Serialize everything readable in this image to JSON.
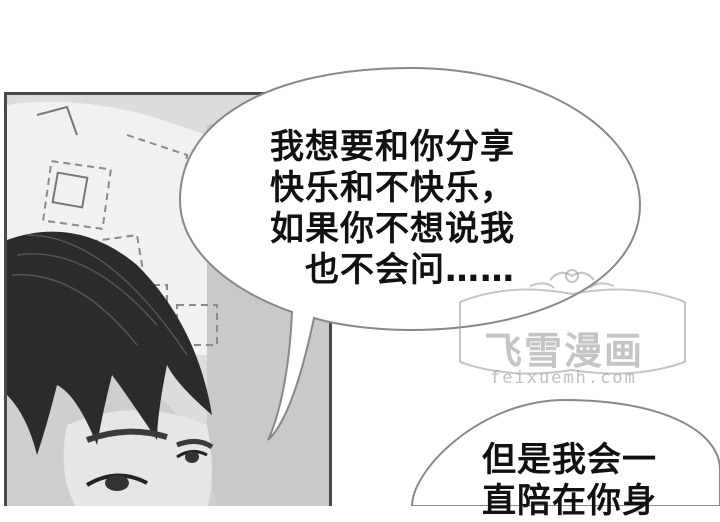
{
  "bubble_top": {
    "lines": [
      "我想要和你分享",
      "快乐和不快乐，",
      "如果你不想说我",
      "　也不会问……"
    ]
  },
  "bubble_bottom": {
    "lines": [
      "但是我会一",
      "直陪在你身"
    ]
  },
  "watermark": {
    "title": "飞雪漫画",
    "url": "feixuemh.com"
  }
}
